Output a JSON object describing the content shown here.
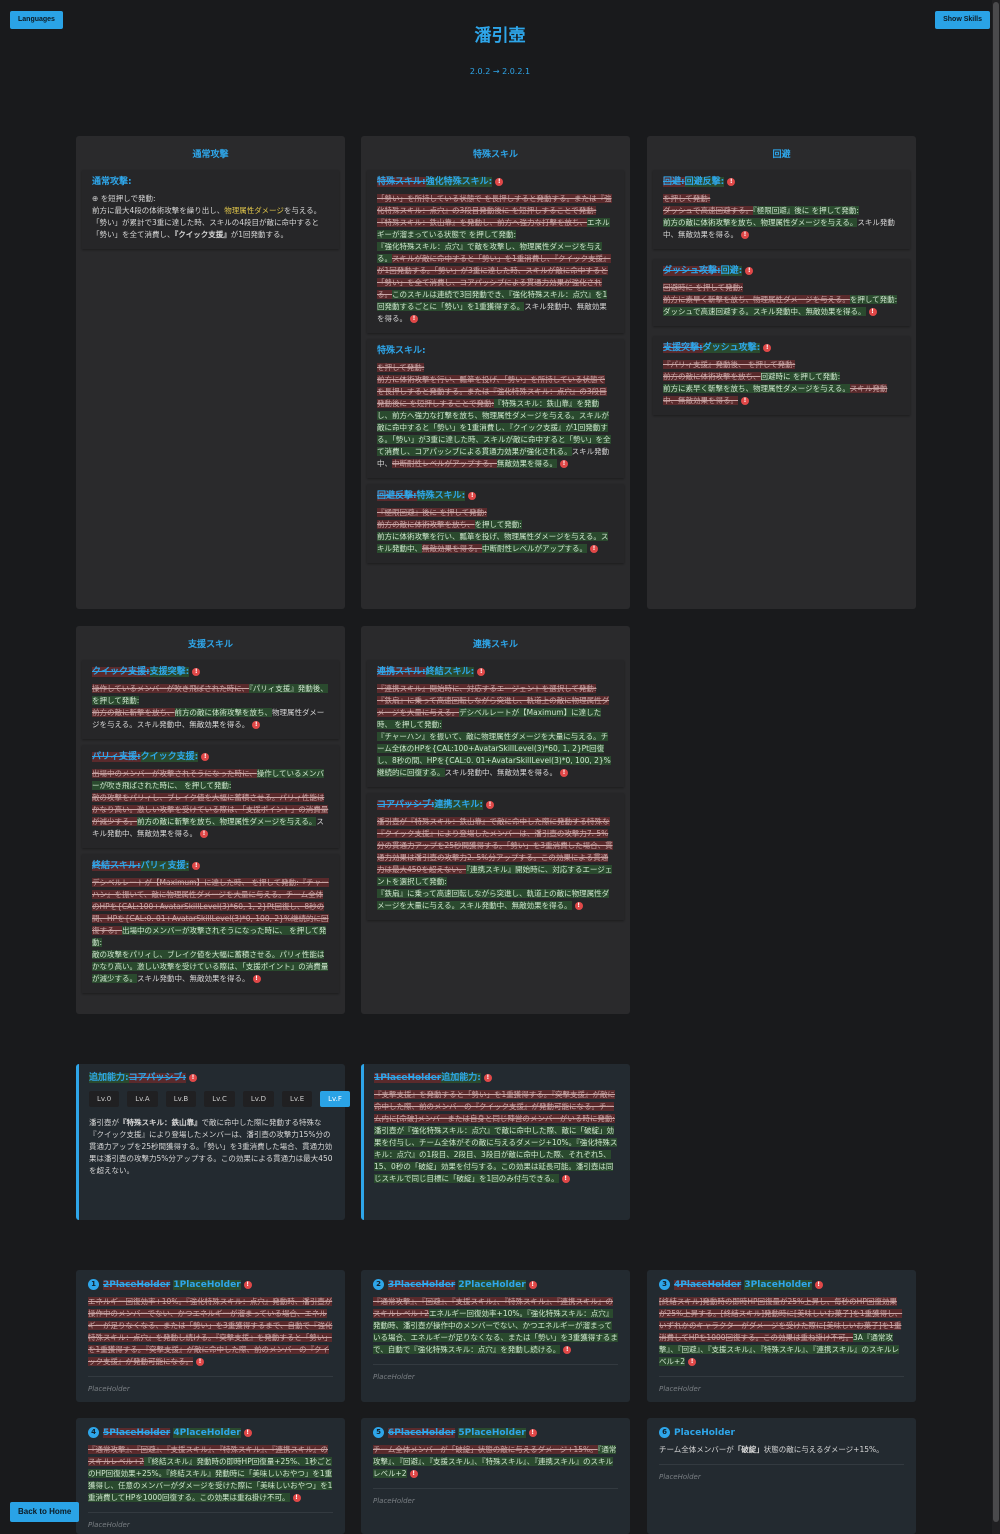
{
  "header": {
    "languages_label": "Languages",
    "show_skills_label": "Show Skills",
    "title": "潘引壺",
    "version": "2.0.2 → 2.0.2.1"
  },
  "columns": {
    "normal": {
      "heading": "通常攻撃",
      "skill_title": "通常攻撃:",
      "line1": "を短押しで発動:",
      "line2a": "前方に最大4段の体術攻撃を繰り出し、",
      "line2b": "物理属性ダメージ",
      "line2c": "を与える。",
      "line3a": "「勢い」が累計で3重に達した時、スキルの4段目が敵に命中すると「勢い」を全て消費し、",
      "line3b": "『クイック支援』",
      "line3c": "が1回発動する。"
    },
    "special": {
      "heading": "特殊スキル",
      "s1_title_old": "特殊スキル:",
      "s1_title_new": "強化特殊スキル:",
      "s1_del1": "「勢い」を所持している状態で を長押しすると発動する。または『強化特殊スキル：点穴』の3段目発動後に を短押しすることで発動:",
      "s1_del2": "『特殊スキル：鉄山靠』を発動し、前方へ強力な打撃を放ち、",
      "s1_ins1": "エネルギーが溜まっている状態で を押して発動:",
      "s1_ins2": "『強化特殊スキル：点穴』で敵を攻撃し、物理属性ダメージを与える。",
      "s1_del3": "スキルが敵に命中すると「勢い」を1重消費し、『クイック支援』が1回発動する。「勢い」が3重に達した時、スキルが敵に命中すると「勢い」を全て消費し、コアパッシブによる貫通力効果が強化される。",
      "s1_ins3": "このスキルは連続で3回発動でき、『強化特殊スキル：点穴』を1回発動するごとに「勢い」を1重獲得する。",
      "s1_tail": "スキル発動中、無敵効果を得る。",
      "s2_title": "特殊スキル:",
      "s2_del1": "を押して発動:",
      "s2_del2": "前方に体術攻撃を行い、瓢箪を投げ、「勢い」を所持している状態で を長押しすると発動する。または『強化特殊スキル：点穴』の3段目発動後に を短押しすることで発動:",
      "s2_ins1": "『特殊スキル：鉄山靠』を発動し、前方へ強力な打撃を放ち、物理属性ダメージを与える。スキルが敵に命中すると「勢い」を1重消費し、『クイック支援』が1回発動する。「勢い」が3重に達した時、スキルが敵に命中すると「勢い」を全て消費し、コアパッシブによる貫通力効果が強化される。",
      "s2_plain": "スキル発動中、",
      "s2_del3": "中断耐性レベルがアップする。",
      "s2_ins2": "無敵効果を得る。",
      "s3_title_old": "回避反撃:",
      "s3_title_new": "特殊スキル:",
      "s3_del1": "『極限回避』後に を押して発動:",
      "s3_del2": "前方の敵に体術攻撃を放ち、",
      "s3_ins1": "を押して発動:",
      "s3_ins2": "前方に体術攻撃を行い、瓢箪を投げ、物理属性ダメージを与える。スキル発動中、",
      "s3_del3": "無敵効果を得る。",
      "s3_ins3": "中断耐性レベルがアップする。"
    },
    "evade": {
      "heading": "回避",
      "e1_title_old": "回避:",
      "e1_title_new": "回避反撃:",
      "e1_del1": "を押して発動:",
      "e1_del2": "ダッシュで高速回避する。",
      "e1_ins1": "『極限回避』後に を押して発動:",
      "e1_ins2": "前方の敵に体術攻撃を放ち、物理属性ダメージを与える。",
      "e1_plain": "スキル発動中、無敵効果を得る。",
      "e2_title_old": "ダッシュ攻撃:",
      "e2_title_new": "回避:",
      "e2_del1": "回避時に を押して発動:",
      "e2_del2": "前方に素早く斬撃を放ち、物理属性ダメージを与える。",
      "e2_ins1": "を押して発動:",
      "e2_ins2": "ダッシュで高速回避する。スキル発動中、無敵効果を得る。",
      "e3_title_old": "支援突撃:",
      "e3_title_new": "ダッシュ攻撃:",
      "e3_del1": "『パリィ支援』発動後、 を押して発動:",
      "e3_del2": "前方の敵に体術攻撃を放ち、",
      "e3_ins1": "回避時に を押して発動:",
      "e3_ins2": "前方に素早く斬撃を放ち、物理属性ダメージを与える。",
      "e3_del3": "スキル発動中、無敵効果を得る。"
    },
    "assist": {
      "heading": "支援スキル",
      "a1_title_old": "クイック支援:",
      "a1_title_new": "支援突撃:",
      "a1_del1": "操作しているメンバーが吹き飛ばされた時に、",
      "a1_ins1": "『パリィ支援』発動後、 を押して発動:",
      "a1_del2": "前方の敵に斬撃を放ち、",
      "a1_ins2": "前方の敵に体術攻撃を放ち、",
      "a1_plain": "物理属性ダメージを与える。スキル発動中、無敵効果を得る。",
      "a2_title_old": "パリィ支援:",
      "a2_title_new": "クイック支援:",
      "a2_del1": "出場中のメンバーが攻撃されそうになった時に、",
      "a2_ins1": "操作しているメンバーが吹き飛ばされた時に、 を押して発動:",
      "a2_del2": "敵の攻撃をパリィし、ブレイク値を大幅に蓄積させる。パリィ性能はかなり高い。激しい攻撃を受けている際は、「支援ポイント」の消費量が減少する。",
      "a2_ins2": "前方の敵に斬撃を放ち、物理属性ダメージを与える。",
      "a2_plain": "スキル発動中、無敵効果を得る。",
      "a3_title_old": "終結スキル:",
      "a3_title_new": "パリィ支援:",
      "a3_del1": "デシベルレートが【Maximum】に達した時、 を押して発動:『チャーハン』を振いて、敵に物理属性ダメージを大量に与える。チーム全体のHPを{CAL:100+AvatarSkillLevel(3)*60, 1, 2}Pt回復し、8秒の間、HPを{CAL:0. 01+AvatarSkillLevel(3)*0, 100, 2}%継続的に回復する。",
      "a3_ins1": "出場中のメンバーが攻撃されそうになった時に、 を押して発動:",
      "a3_ins2": "敵の攻撃をパリィし、ブレイク値を大幅に蓄積させる。パリィ性能はかなり高い。激しい攻撃を受けている際は、「支援ポイント」の消費量が減少する。",
      "a3_plain": "スキル発動中、無敵効果を得る。"
    },
    "chain": {
      "heading": "連携スキル",
      "c1_title_old": "連携スキル:",
      "c1_title_new": "終結スキル:",
      "c1_del1": "『連携スキル』開始時に、対応するエージェントを選択して発動:",
      "c1_del2": "『鉄扇』に乗って高速回転しながら突進し、軌道上の敵に物理属性ダメージを大量に与える。",
      "c1_ins1": "デシベルレートが【Maximum】に達した時、 を押して発動:",
      "c1_ins2": "『チャーハン』を振いて、敵に物理属性ダメージを大量に与える。チーム全体のHPを{CAL:100+AvatarSkillLevel(3)*60, 1, 2}Pt回復し、8秒の間、HPを{CAL:0. 01+AvatarSkillLevel(3)*0, 100, 2}%継続的に回復する。",
      "c1_plain": "スキル発動中、無敵効果を得る。",
      "c2_title_old": "コアパッシブ:",
      "c2_title_new": "連携スキル:",
      "c2_del1": "潘引壺が『特殊スキル：鉄山靠』で敵に命中した際に発動する特殊な『クイック支援』により登場したメンバーは、潘引壺の攻撃力7. 5%分の貫通力アップを25秒間獲得する。「勢い」を3重消費した場合、貫通力効果は潘引壺の攻撃力2. 5%分アップする。この効果による貫通力は最大450を超えない。",
      "c2_ins1": "『連携スキル』開始時に、対応するエージェントを選択して発動:",
      "c2_ins2": "『鉄扇』に乗って高速回転しながら突進し、軌道上の敵に物理属性ダメージを大量に与える。スキル発動中、無敵効果を得る。"
    }
  },
  "core_panel": {
    "title_old": "追加能力:",
    "title_new": "コアパッシブ:",
    "levels": [
      "Lv.0",
      "Lv.A",
      "Lv.B",
      "Lv.C",
      "Lv.D",
      "Lv.E",
      "Lv.F"
    ],
    "active_level": "Lv.F",
    "body1": "潘引壺が",
    "body1b": "『特殊スキル：鉄山靠』",
    "body1c": "で敵に命中した際に発動する特殊な『クイック支援』により登場したメンバーは、潘引壺の攻撃力15%分の貫通力アップを25秒間獲得する。「勢い」を3重消費した場合、貫通力効果は潘引壺の攻撃力5%分アップする。この効果による貫通力は最大450を超えない。"
  },
  "extra_panel": {
    "title_del": "1PlaceHolder",
    "title_ins": "追加能力:",
    "del1": "『支撃支援』を発動すると「勢い」を1重獲得する。『突撃支援』が敵に命中した際、前のメンバーの『クイック支援』が発動可能になる。チーム内に[命破]メンバーまたは自身と同じ陣営のメンバーがいる時に発動:",
    "ins1": "潘引壺が『強化特殊スキル：点穴』で敵に命中した際、敵に「破綻」効果を付与し、チーム全体がその敵に与えるダメージ+10%。『強化特殊スキル：点穴』の1段目、2段目、3段目が敵に命中した際、それぞれ5、15、0秒の「破綻」効果を付与する。この効果は延長可能。潘引壺は同じスキルで同じ目標に「破綻」を1回のみ付与できる。"
  },
  "mindscapes": [
    {
      "num": "1",
      "title_del": "2PlaceHolder",
      "title_ins": "1PlaceHolder",
      "del": "エネルギー回復効率+10%。『強化特殊スキル：点穴』発動時、潘引壺が操作中のメンバーでない、かつエネルギーが溜まっている場合、エネルギーが足りなくなる、または「勢い」を3重獲得するまで、自動で『強化特殊スキル：点穴』を発動し続ける。『突撃支援』を発動すると「勢い」を1重獲得する。『突撃支援』が敵に命中した際、前のメンバーの『クイック支援』が発動可能になる。",
      "ins": "",
      "footer": "PlaceHolder"
    },
    {
      "num": "2",
      "title_del": "3PlaceHolder",
      "title_ins": "2PlaceHolder",
      "del": "『通常攻撃』、『回避』、『支援スキル』、『特殊スキル』、『連携スキル』のスキルレベル+2",
      "ins": "エネルギー回復効率+10%。『強化特殊スキル：点穴』発動時、潘引壺が操作中のメンバーでない、かつエネルギーが溜まっている場合、エネルギーが足りなくなる、または「勢い」を3重獲得するまで、自動で『強化特殊スキル：点穴』を発動し続ける。",
      "footer": "PlaceHolder"
    },
    {
      "num": "3",
      "title_del": "4PlaceHolder",
      "title_ins": "3PlaceHolder",
      "del": "[終結スキル]発動時の即時HP回復量が25%上昇し、毎秒のHP回復効果が25%上昇する。[終結スキル]発動時に[美味しいお菓子]を1重獲得し、いずれかのキャラクターがダメージを受けた際に[美味しいお菓子]を1重消費してHPを1000回復する。この効果は重ね掛け不可。",
      "ins": "3A『通常攻撃』、『回避』、『支援スキル』、『特殊スキル』、『連携スキル』のスキルレベル+2",
      "footer": "PlaceHolder"
    },
    {
      "num": "4",
      "title_del": "5PlaceHolder",
      "title_ins": "4PlaceHolder",
      "del": "『通常攻撃』、『回避』、『支援スキル』、『特殊スキル』、『連携スキル』のスキルレベル+2",
      "ins": "『終結スキル』発動時の即時HP回復量+25%、1秒ごとのHP回復効果+25%。『終結スキル』発動時に「美味しいおやつ」を1重獲得し、任意のメンバーがダメージを受けた際に「美味しいおやつ」を1重消費してHPを1000回復する。この効果は重ね掛け不可。",
      "footer": "PlaceHolder"
    },
    {
      "num": "5",
      "title_del": "6PlaceHolder",
      "title_ins": "5PlaceHolder",
      "del": "チーム全体メンバーが「破綻」状態の敵に与えるダメージ+15%。",
      "ins": "『通常攻撃』、『回避』、『支援スキル』、『特殊スキル』、『連携スキル』のスキルレベル+2",
      "footer": "PlaceHolder"
    },
    {
      "num": "6",
      "title_plain": "PlaceHolder",
      "body_a": "チーム全体メンバーが",
      "body_b": "「破綻」",
      "body_c": "状態の敵に与えるダメージ+15%。",
      "footer": "PlaceHolder"
    }
  ],
  "back_home_label": "Back to Home"
}
